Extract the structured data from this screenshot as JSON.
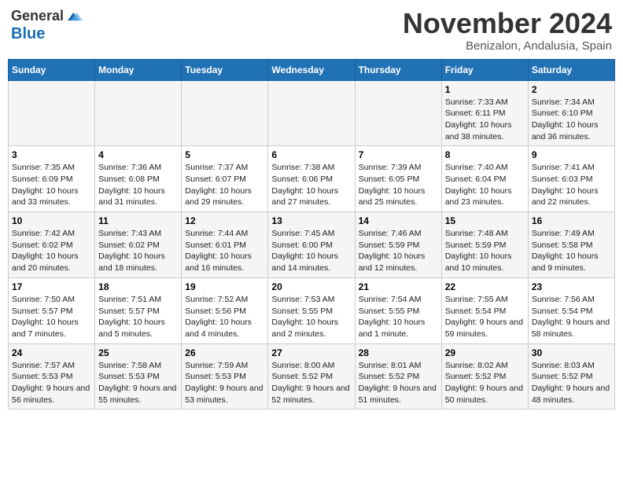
{
  "header": {
    "logo_line1": "General",
    "logo_line2": "Blue",
    "month": "November 2024",
    "location": "Benizalon, Andalusia, Spain"
  },
  "weekdays": [
    "Sunday",
    "Monday",
    "Tuesday",
    "Wednesday",
    "Thursday",
    "Friday",
    "Saturday"
  ],
  "weeks": [
    [
      {
        "day": "",
        "info": ""
      },
      {
        "day": "",
        "info": ""
      },
      {
        "day": "",
        "info": ""
      },
      {
        "day": "",
        "info": ""
      },
      {
        "day": "",
        "info": ""
      },
      {
        "day": "1",
        "info": "Sunrise: 7:33 AM\nSunset: 6:11 PM\nDaylight: 10 hours and 38 minutes."
      },
      {
        "day": "2",
        "info": "Sunrise: 7:34 AM\nSunset: 6:10 PM\nDaylight: 10 hours and 36 minutes."
      }
    ],
    [
      {
        "day": "3",
        "info": "Sunrise: 7:35 AM\nSunset: 6:09 PM\nDaylight: 10 hours and 33 minutes."
      },
      {
        "day": "4",
        "info": "Sunrise: 7:36 AM\nSunset: 6:08 PM\nDaylight: 10 hours and 31 minutes."
      },
      {
        "day": "5",
        "info": "Sunrise: 7:37 AM\nSunset: 6:07 PM\nDaylight: 10 hours and 29 minutes."
      },
      {
        "day": "6",
        "info": "Sunrise: 7:38 AM\nSunset: 6:06 PM\nDaylight: 10 hours and 27 minutes."
      },
      {
        "day": "7",
        "info": "Sunrise: 7:39 AM\nSunset: 6:05 PM\nDaylight: 10 hours and 25 minutes."
      },
      {
        "day": "8",
        "info": "Sunrise: 7:40 AM\nSunset: 6:04 PM\nDaylight: 10 hours and 23 minutes."
      },
      {
        "day": "9",
        "info": "Sunrise: 7:41 AM\nSunset: 6:03 PM\nDaylight: 10 hours and 22 minutes."
      }
    ],
    [
      {
        "day": "10",
        "info": "Sunrise: 7:42 AM\nSunset: 6:02 PM\nDaylight: 10 hours and 20 minutes."
      },
      {
        "day": "11",
        "info": "Sunrise: 7:43 AM\nSunset: 6:02 PM\nDaylight: 10 hours and 18 minutes."
      },
      {
        "day": "12",
        "info": "Sunrise: 7:44 AM\nSunset: 6:01 PM\nDaylight: 10 hours and 16 minutes."
      },
      {
        "day": "13",
        "info": "Sunrise: 7:45 AM\nSunset: 6:00 PM\nDaylight: 10 hours and 14 minutes."
      },
      {
        "day": "14",
        "info": "Sunrise: 7:46 AM\nSunset: 5:59 PM\nDaylight: 10 hours and 12 minutes."
      },
      {
        "day": "15",
        "info": "Sunrise: 7:48 AM\nSunset: 5:59 PM\nDaylight: 10 hours and 10 minutes."
      },
      {
        "day": "16",
        "info": "Sunrise: 7:49 AM\nSunset: 5:58 PM\nDaylight: 10 hours and 9 minutes."
      }
    ],
    [
      {
        "day": "17",
        "info": "Sunrise: 7:50 AM\nSunset: 5:57 PM\nDaylight: 10 hours and 7 minutes."
      },
      {
        "day": "18",
        "info": "Sunrise: 7:51 AM\nSunset: 5:57 PM\nDaylight: 10 hours and 5 minutes."
      },
      {
        "day": "19",
        "info": "Sunrise: 7:52 AM\nSunset: 5:56 PM\nDaylight: 10 hours and 4 minutes."
      },
      {
        "day": "20",
        "info": "Sunrise: 7:53 AM\nSunset: 5:55 PM\nDaylight: 10 hours and 2 minutes."
      },
      {
        "day": "21",
        "info": "Sunrise: 7:54 AM\nSunset: 5:55 PM\nDaylight: 10 hours and 1 minute."
      },
      {
        "day": "22",
        "info": "Sunrise: 7:55 AM\nSunset: 5:54 PM\nDaylight: 9 hours and 59 minutes."
      },
      {
        "day": "23",
        "info": "Sunrise: 7:56 AM\nSunset: 5:54 PM\nDaylight: 9 hours and 58 minutes."
      }
    ],
    [
      {
        "day": "24",
        "info": "Sunrise: 7:57 AM\nSunset: 5:53 PM\nDaylight: 9 hours and 56 minutes."
      },
      {
        "day": "25",
        "info": "Sunrise: 7:58 AM\nSunset: 5:53 PM\nDaylight: 9 hours and 55 minutes."
      },
      {
        "day": "26",
        "info": "Sunrise: 7:59 AM\nSunset: 5:53 PM\nDaylight: 9 hours and 53 minutes."
      },
      {
        "day": "27",
        "info": "Sunrise: 8:00 AM\nSunset: 5:52 PM\nDaylight: 9 hours and 52 minutes."
      },
      {
        "day": "28",
        "info": "Sunrise: 8:01 AM\nSunset: 5:52 PM\nDaylight: 9 hours and 51 minutes."
      },
      {
        "day": "29",
        "info": "Sunrise: 8:02 AM\nSunset: 5:52 PM\nDaylight: 9 hours and 50 minutes."
      },
      {
        "day": "30",
        "info": "Sunrise: 8:03 AM\nSunset: 5:52 PM\nDaylight: 9 hours and 48 minutes."
      }
    ]
  ]
}
